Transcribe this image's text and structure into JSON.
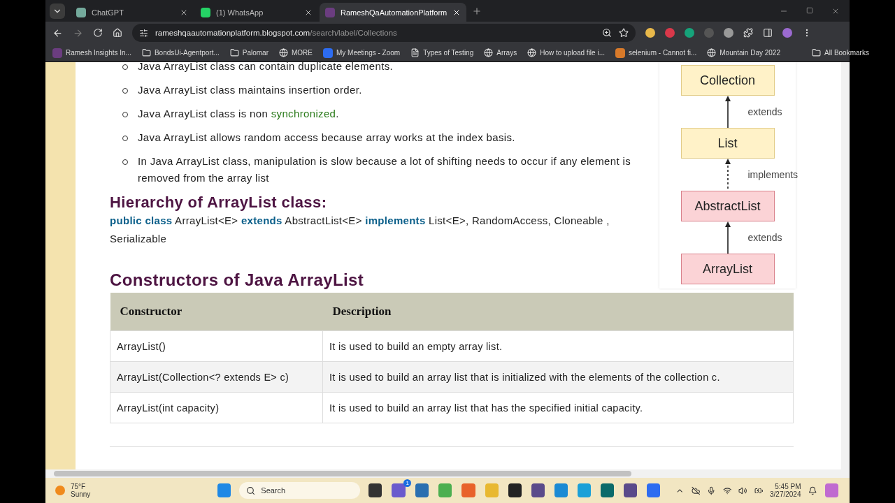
{
  "tabs": [
    {
      "title": "ChatGPT",
      "kind": "chatgpt",
      "selected": false
    },
    {
      "title": "(1) WhatsApp",
      "kind": "whatsapp",
      "selected": false
    },
    {
      "title": "RameshQaAutomationPlatform",
      "kind": "blog",
      "selected": true
    }
  ],
  "address": {
    "host": "rameshqaautomationplatform.blogspot.com",
    "path": "/search/label/Collections"
  },
  "bookmarks": [
    {
      "label": "Ramesh Insights In...",
      "kind": "blog"
    },
    {
      "label": "BondsUi-Agentport...",
      "kind": "folder"
    },
    {
      "label": "Palomar",
      "kind": "folder"
    },
    {
      "label": "MORE",
      "kind": "globe"
    },
    {
      "label": "My Meetings - Zoom",
      "kind": "zoom"
    },
    {
      "label": "Types of Testing",
      "kind": "page"
    },
    {
      "label": "Arrays",
      "kind": "globe"
    },
    {
      "label": "How to upload file i...",
      "kind": "globe"
    },
    {
      "label": "selenium - Cannot fi...",
      "kind": "stack"
    },
    {
      "label": "Mountain Day 2022",
      "kind": "globe"
    }
  ],
  "all_bookmarks": "All Bookmarks",
  "bullets": [
    [
      {
        "text": "Java ArrayList class can contain duplicate elements."
      }
    ],
    [
      {
        "text": "Java ArrayList class maintains insertion order."
      }
    ],
    [
      {
        "text": "Java ArrayList class is non "
      },
      {
        "text": "synchronized",
        "kind": "link"
      },
      {
        "text": "."
      }
    ],
    [
      {
        "text": "Java ArrayList allows random access because array works at the index basis."
      }
    ],
    [
      {
        "text": "In Java ArrayList class, manipulation is slow because a lot of shifting needs to occur if any element is removed from the array list"
      }
    ]
  ],
  "hierarchy_heading": "Hierarchy of ArrayList class:",
  "declaration": "**public class** ArrayList<E> **extends** AbstractList<E> **implements** List<E>, RandomAccess, Cloneable , Serializable",
  "diagram": {
    "nodes": [
      {
        "label": "Collection",
        "kind": "interface"
      },
      {
        "label": "List",
        "kind": "interface",
        "edge": {
          "label": "extends",
          "kind": "solid"
        }
      },
      {
        "label": "AbstractList",
        "kind": "class",
        "edge": {
          "label": "implements",
          "kind": "dashed"
        }
      },
      {
        "label": "ArrayList",
        "kind": "class",
        "edge": {
          "label": "extends",
          "kind": "solid"
        }
      }
    ]
  },
  "constructors_heading": "Constructors of Java ArrayList",
  "table": {
    "columns": [
      "Constructor",
      "Description"
    ],
    "rows": [
      [
        "ArrayList()",
        "It is used to build an empty array list."
      ],
      [
        "ArrayList(Collection<? extends E> c)",
        "It is used to build an array list that is initialized with the elements of the collection c."
      ],
      [
        "ArrayList(int capacity)",
        "It is used to build an array list that has the specified initial capacity."
      ]
    ]
  },
  "taskbar": {
    "temperature": "75°F",
    "condition": "Sunny",
    "search_placeholder": "Search",
    "chat_badge": "1",
    "time": "5:45 PM",
    "date": "3/27/2024"
  }
}
